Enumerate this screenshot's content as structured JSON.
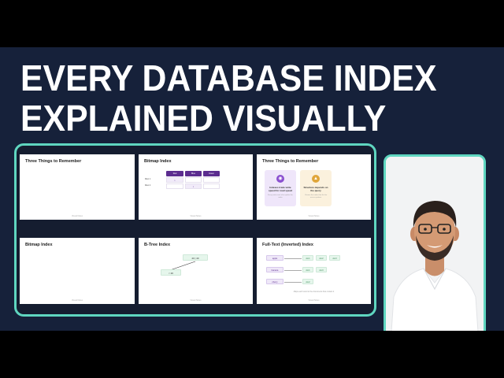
{
  "headline": {
    "line1": "EVERY DATABASE INDEX",
    "line2": "EXPLAINED VISUALLY"
  },
  "slides": [
    {
      "title": "Three Things to Remember",
      "footer": "Visual Notes"
    },
    {
      "title": "Bitmap Index",
      "footer": "Visual Notes",
      "columns": [
        "Red",
        "Blue",
        "Green"
      ],
      "rows": [
        "Row 1",
        "Row 2"
      ],
      "cells": [
        [
          "1",
          "",
          ""
        ],
        [
          "",
          "1",
          ""
        ]
      ]
    },
    {
      "title": "Three Things to Remember",
      "footer": "Visual Notes",
      "cards": [
        {
          "title": "Indexes trade write speed for read speed",
          "sub": "Every write must also update the index"
        },
        {
          "title": "Structure depends on the query",
          "sub": "Choose the index that fits the access pattern"
        }
      ]
    },
    {
      "title": "Bitmap Index",
      "footer": "Visual Notes"
    },
    {
      "title": "B-Tree Index",
      "footer": "Visual Notes",
      "nodes": [
        "20 | 40",
        "< 20"
      ]
    },
    {
      "title": "Full-Text (Inverted) Index",
      "footer": "Visual Notes",
      "terms": [
        "apple",
        "banana",
        "cherry"
      ],
      "docs": [
        [
          "doc1",
          "doc2",
          "doc3"
        ],
        [
          "doc1",
          "doc3"
        ],
        [
          "doc2"
        ]
      ],
      "caption": "Maps each word to the documents that contain it"
    }
  ],
  "colors": {
    "background": "#16213a",
    "accent": "#5fd6c0",
    "purple": "#5b2c8f"
  }
}
